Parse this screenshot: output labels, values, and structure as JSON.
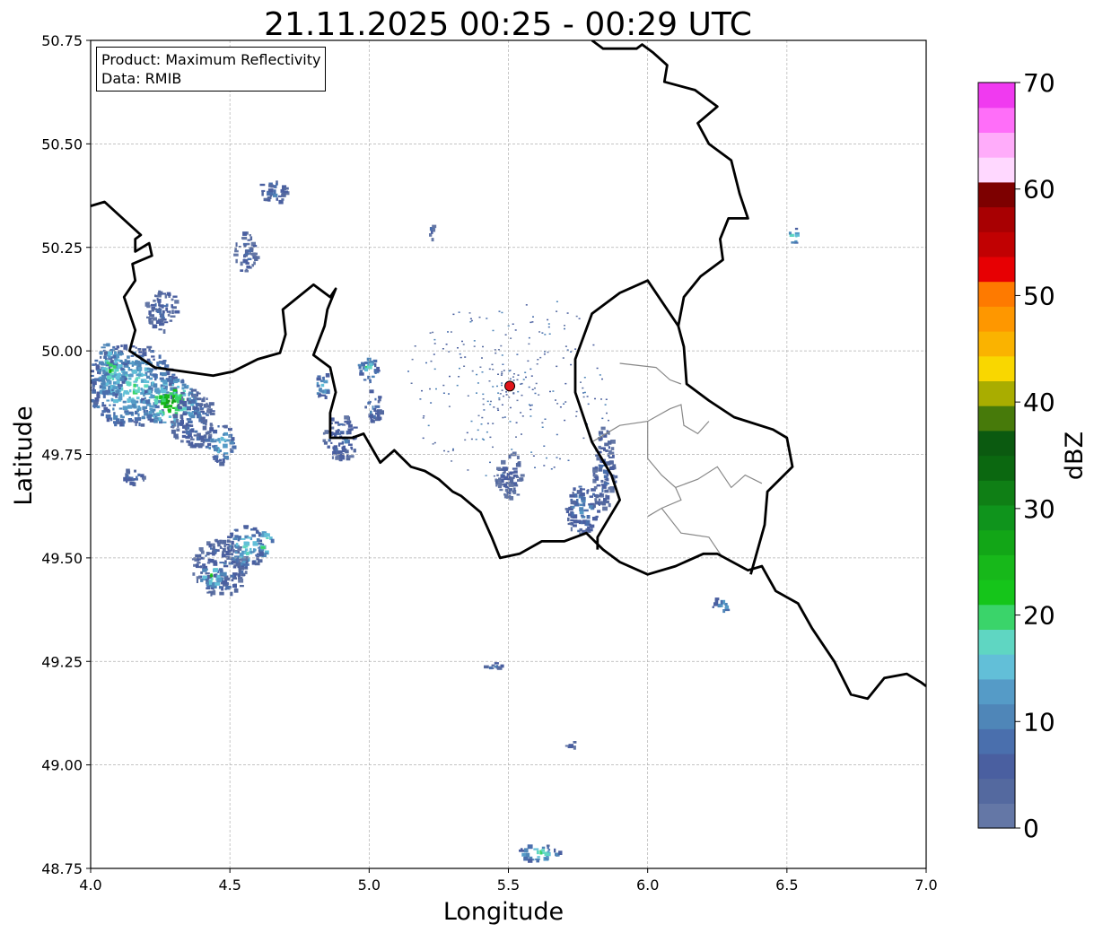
{
  "title": "21.11.2025 00:25 - 00:29 UTC",
  "xlabel": "Longitude",
  "ylabel": "Latitude",
  "legend": {
    "product": "Product: Maximum Reflectivity",
    "data": "Data: RMIB"
  },
  "colorbar": {
    "label": "dBZ",
    "ticks": [
      "0",
      "10",
      "20",
      "30",
      "40",
      "50",
      "60",
      "70"
    ],
    "range": [
      0,
      70
    ],
    "colors": [
      "#6477a6",
      "#54699f",
      "#4a5fa0",
      "#4a6fad",
      "#4f86b8",
      "#559bc7",
      "#62bfd8",
      "#5fd6c2",
      "#3ad46a",
      "#15c51a",
      "#17b81a",
      "#12a617",
      "#0f941c",
      "#0f7f15",
      "#0b6810",
      "#0b5a10",
      "#477a0a",
      "#a9ad00",
      "#f9d700",
      "#fab300",
      "#fe9700",
      "#fe7a00",
      "#e70003",
      "#c10102",
      "#a80002",
      "#7d0000",
      "#ffd8ff",
      "#ffacfa",
      "#ff6ef9",
      "#f03af0"
    ]
  },
  "chart_data": {
    "type": "map",
    "title": "21.11.2025 00:25 - 00:29 UTC",
    "xlabel": "Longitude",
    "ylabel": "Latitude",
    "xlim": [
      4.0,
      7.0
    ],
    "ylim": [
      48.75,
      50.75
    ],
    "xticks": [
      "4.0",
      "4.5",
      "5.0",
      "5.5",
      "6.0",
      "6.5",
      "7.0"
    ],
    "yticks": [
      "48.75",
      "49.00",
      "49.25",
      "49.50",
      "49.75",
      "50.00",
      "50.25",
      "50.50",
      "50.75"
    ],
    "grid": true,
    "radar_site": {
      "lon": 5.505,
      "lat": 49.915
    },
    "echo_areas": [
      {
        "lon": 4.14,
        "lat": 49.92,
        "rlon": 0.16,
        "rlat": 0.1,
        "dbz": 16
      },
      {
        "lon": 4.28,
        "lat": 49.88,
        "rlon": 0.1,
        "rlat": 0.06,
        "dbz": 24
      },
      {
        "lon": 4.36,
        "lat": 49.84,
        "rlon": 0.08,
        "rlat": 0.07,
        "dbz": 8
      },
      {
        "lon": 4.46,
        "lat": 49.78,
        "rlon": 0.05,
        "rlat": 0.05,
        "dbz": 14
      },
      {
        "lon": 4.07,
        "lat": 49.96,
        "rlon": 0.05,
        "rlat": 0.07,
        "dbz": 20
      },
      {
        "lon": 4.25,
        "lat": 50.1,
        "rlon": 0.06,
        "rlat": 0.05,
        "dbz": 6
      },
      {
        "lon": 4.46,
        "lat": 49.48,
        "rlon": 0.1,
        "rlat": 0.07,
        "dbz": 8
      },
      {
        "lon": 4.55,
        "lat": 49.53,
        "rlon": 0.07,
        "rlat": 0.05,
        "dbz": 16
      },
      {
        "lon": 4.43,
        "lat": 49.46,
        "rlon": 0.04,
        "rlat": 0.03,
        "dbz": 22
      },
      {
        "lon": 4.62,
        "lat": 49.54,
        "rlon": 0.03,
        "rlat": 0.03,
        "dbz": 24
      },
      {
        "lon": 4.55,
        "lat": 50.24,
        "rlon": 0.04,
        "rlat": 0.05,
        "dbz": 6
      },
      {
        "lon": 4.65,
        "lat": 50.39,
        "rlon": 0.05,
        "rlat": 0.03,
        "dbz": 8
      },
      {
        "lon": 4.15,
        "lat": 49.7,
        "rlon": 0.04,
        "rlat": 0.02,
        "dbz": 8
      },
      {
        "lon": 4.89,
        "lat": 49.79,
        "rlon": 0.06,
        "rlat": 0.06,
        "dbz": 8
      },
      {
        "lon": 4.83,
        "lat": 49.92,
        "rlon": 0.03,
        "rlat": 0.03,
        "dbz": 16
      },
      {
        "lon": 4.99,
        "lat": 49.96,
        "rlon": 0.04,
        "rlat": 0.03,
        "dbz": 16
      },
      {
        "lon": 5.01,
        "lat": 49.87,
        "rlon": 0.03,
        "rlat": 0.04,
        "dbz": 10
      },
      {
        "lon": 5.76,
        "lat": 49.62,
        "rlon": 0.06,
        "rlat": 0.06,
        "dbz": 10
      },
      {
        "lon": 5.84,
        "lat": 49.72,
        "rlon": 0.04,
        "rlat": 0.1,
        "dbz": 6
      },
      {
        "lon": 6.26,
        "lat": 49.39,
        "rlon": 0.03,
        "rlat": 0.02,
        "dbz": 14
      },
      {
        "lon": 5.6,
        "lat": 48.79,
        "rlon": 0.08,
        "rlat": 0.02,
        "dbz": 18
      },
      {
        "lon": 5.72,
        "lat": 49.05,
        "rlon": 0.02,
        "rlat": 0.01,
        "dbz": 6
      },
      {
        "lon": 5.45,
        "lat": 49.24,
        "rlon": 0.04,
        "rlat": 0.01,
        "dbz": 6
      },
      {
        "lon": 5.5,
        "lat": 49.7,
        "rlon": 0.05,
        "rlat": 0.06,
        "dbz": 4
      },
      {
        "lon": 6.52,
        "lat": 50.28,
        "rlon": 0.02,
        "rlat": 0.02,
        "dbz": 20
      },
      {
        "lon": 5.22,
        "lat": 50.29,
        "rlon": 0.01,
        "rlat": 0.02,
        "dbz": 6
      }
    ],
    "borders": {
      "france_belgium": [
        [
          4.0,
          50.35
        ],
        [
          4.05,
          50.36
        ],
        [
          4.18,
          50.28
        ],
        [
          4.16,
          50.27
        ],
        [
          4.16,
          50.24
        ],
        [
          4.21,
          50.26
        ],
        [
          4.22,
          50.23
        ],
        [
          4.15,
          50.21
        ],
        [
          4.16,
          50.17
        ],
        [
          4.12,
          50.13
        ],
        [
          4.16,
          50.05
        ],
        [
          4.14,
          50.0
        ],
        [
          4.23,
          49.96
        ],
        [
          4.44,
          49.94
        ],
        [
          4.51,
          49.95
        ],
        [
          4.6,
          49.98
        ],
        [
          4.68,
          49.995
        ],
        [
          4.7,
          50.04
        ],
        [
          4.69,
          50.1
        ],
        [
          4.8,
          50.16
        ],
        [
          4.86,
          50.13
        ],
        [
          4.88,
          50.15
        ],
        [
          4.85,
          50.1
        ],
        [
          4.84,
          50.06
        ],
        [
          4.8,
          49.99
        ],
        [
          4.86,
          49.96
        ],
        [
          4.88,
          49.9
        ],
        [
          4.86,
          49.85
        ],
        [
          4.86,
          49.79
        ],
        [
          4.94,
          49.79
        ],
        [
          4.98,
          49.8
        ],
        [
          5.04,
          49.73
        ],
        [
          5.09,
          49.76
        ],
        [
          5.15,
          49.72
        ],
        [
          5.2,
          49.71
        ],
        [
          5.25,
          49.69
        ],
        [
          5.3,
          49.66
        ],
        [
          5.33,
          49.65
        ],
        [
          5.4,
          49.61
        ],
        [
          5.44,
          49.55
        ],
        [
          5.47,
          49.5
        ],
        [
          5.54,
          49.51
        ],
        [
          5.62,
          49.54
        ],
        [
          5.7,
          49.54
        ],
        [
          5.78,
          49.56
        ],
        [
          5.84,
          49.52
        ],
        [
          5.9,
          49.49
        ],
        [
          6.0,
          49.46
        ],
        [
          6.1,
          49.48
        ],
        [
          6.2,
          49.51
        ],
        [
          6.25,
          49.51
        ],
        [
          6.36,
          49.47
        ],
        [
          6.41,
          49.48
        ],
        [
          6.46,
          49.42
        ],
        [
          6.54,
          49.39
        ],
        [
          6.59,
          49.33
        ],
        [
          6.67,
          49.25
        ],
        [
          6.73,
          49.17
        ],
        [
          6.79,
          49.16
        ],
        [
          6.85,
          49.21
        ],
        [
          6.93,
          49.22
        ],
        [
          6.98,
          49.2
        ],
        [
          7.0,
          49.19
        ]
      ],
      "belgium_germany": [
        [
          5.8,
          50.75
        ],
        [
          5.84,
          50.73
        ],
        [
          5.96,
          50.73
        ],
        [
          5.98,
          50.74
        ],
        [
          6.02,
          50.72
        ],
        [
          6.07,
          50.69
        ],
        [
          6.06,
          50.65
        ],
        [
          6.17,
          50.63
        ],
        [
          6.25,
          50.59
        ],
        [
          6.18,
          50.55
        ],
        [
          6.22,
          50.5
        ],
        [
          6.26,
          50.48
        ],
        [
          6.3,
          50.46
        ],
        [
          6.33,
          50.38
        ],
        [
          6.36,
          50.32
        ],
        [
          6.29,
          50.32
        ],
        [
          6.26,
          50.27
        ],
        [
          6.27,
          50.22
        ],
        [
          6.19,
          50.18
        ],
        [
          6.13,
          50.13
        ],
        [
          6.11,
          50.06
        ]
      ],
      "lux_belgium": [
        [
          6.11,
          50.06
        ],
        [
          6.0,
          50.17
        ],
        [
          5.9,
          50.14
        ],
        [
          5.8,
          50.09
        ],
        [
          5.74,
          49.98
        ],
        [
          5.74,
          49.9
        ],
        [
          5.8,
          49.78
        ],
        [
          5.87,
          49.7
        ],
        [
          5.9,
          49.64
        ],
        [
          5.82,
          49.55
        ],
        [
          5.82,
          49.52
        ]
      ],
      "lux_germany": [
        [
          6.11,
          50.06
        ],
        [
          6.13,
          50.01
        ],
        [
          6.14,
          49.92
        ],
        [
          6.22,
          49.88
        ],
        [
          6.31,
          49.84
        ],
        [
          6.45,
          49.81
        ],
        [
          6.5,
          49.79
        ],
        [
          6.52,
          49.72
        ],
        [
          6.43,
          49.66
        ],
        [
          6.42,
          49.58
        ],
        [
          6.37,
          49.46
        ]
      ]
    },
    "provinces": [
      [
        [
          5.8,
          49.78
        ],
        [
          5.9,
          49.82
        ],
        [
          6.0,
          49.83
        ],
        [
          6.08,
          49.86
        ],
        [
          6.12,
          49.87
        ],
        [
          6.13,
          49.82
        ],
        [
          6.18,
          49.8
        ],
        [
          6.22,
          49.83
        ]
      ],
      [
        [
          6.0,
          49.83
        ],
        [
          6.0,
          49.74
        ],
        [
          6.05,
          49.7
        ],
        [
          6.1,
          49.67
        ],
        [
          6.12,
          49.64
        ],
        [
          6.05,
          49.62
        ],
        [
          6.0,
          49.6
        ]
      ],
      [
        [
          6.1,
          49.67
        ],
        [
          6.18,
          49.69
        ],
        [
          6.25,
          49.72
        ],
        [
          6.3,
          49.67
        ],
        [
          6.35,
          49.7
        ],
        [
          6.41,
          49.68
        ]
      ],
      [
        [
          6.05,
          49.62
        ],
        [
          6.12,
          49.56
        ],
        [
          6.22,
          49.55
        ],
        [
          6.27,
          49.5
        ]
      ],
      [
        [
          5.9,
          49.97
        ],
        [
          6.03,
          49.96
        ],
        [
          6.08,
          49.93
        ],
        [
          6.12,
          49.92
        ]
      ]
    ]
  }
}
